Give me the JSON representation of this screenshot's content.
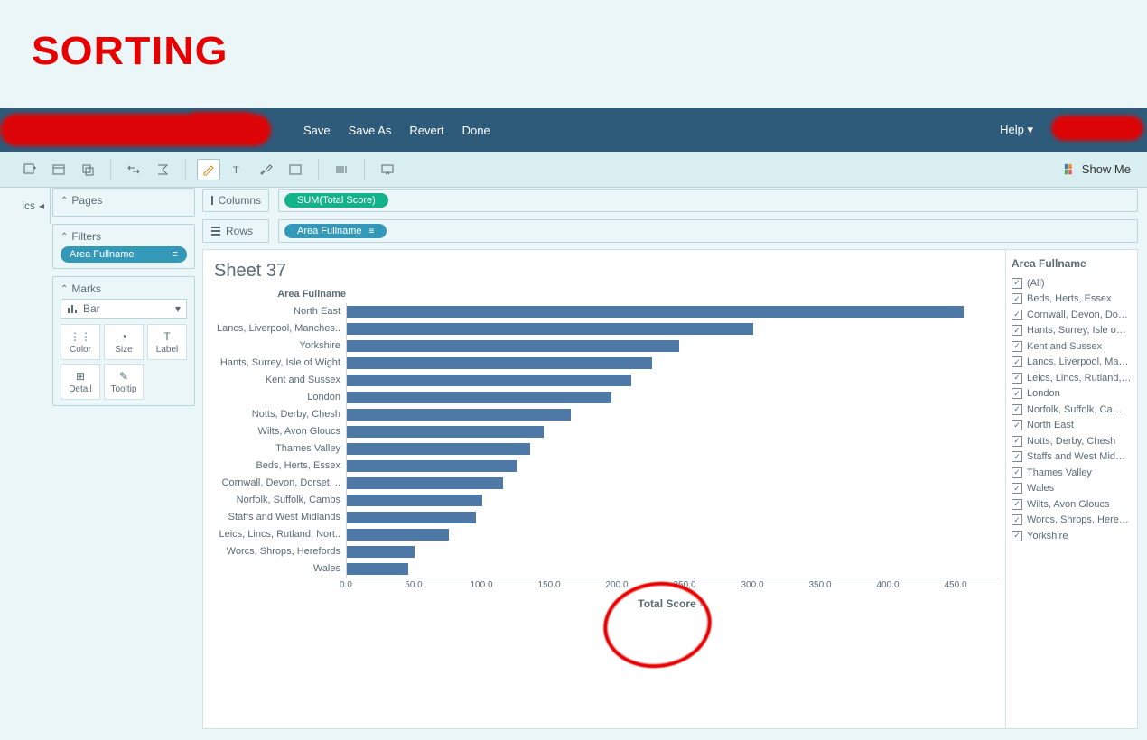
{
  "heading": "SORTING",
  "topbar": {
    "menu": [
      "Save",
      "Save As",
      "Revert",
      "Done"
    ],
    "help": "Help ▾"
  },
  "toolbar": {
    "showme": "Show Me"
  },
  "leftStub": "ics",
  "panels": {
    "pages": "Pages",
    "filters": "Filters",
    "filterPill": "Area Fullname",
    "marks": "Marks",
    "marksType": "Bar",
    "cards": [
      "Color",
      "Size",
      "Label",
      "Detail",
      "Tooltip"
    ]
  },
  "shelves": {
    "columnsLabel": "Columns",
    "columnsPill": "SUM(Total Score)",
    "rowsLabel": "Rows",
    "rowsPill": "Area Fullname"
  },
  "sheet": {
    "title": "Sheet 37",
    "yHeader": "Area Fullname",
    "xTitle": "Total Score"
  },
  "chart_data": {
    "type": "bar",
    "title": "Sheet 37",
    "xlabel": "Total Score",
    "ylabel": "Area Fullname",
    "xlim": [
      0,
      460
    ],
    "ticks": [
      0,
      50,
      100,
      150,
      200,
      250,
      300,
      350,
      400,
      450
    ],
    "categories": [
      "North East",
      "Lancs, Liverpool, Manches..",
      "Yorkshire",
      "Hants, Surrey, Isle of Wight",
      "Kent and Sussex",
      "London",
      "Notts, Derby, Chesh",
      "Wilts, Avon Gloucs",
      "Thames Valley",
      "Beds, Herts, Essex",
      "Cornwall, Devon, Dorset, ..",
      "Norfolk, Suffolk, Cambs",
      "Staffs and West Midlands",
      "Leics, Lincs, Rutland, Nort..",
      "Worcs, Shrops, Herefords",
      "Wales"
    ],
    "values": [
      455,
      300,
      245,
      225,
      210,
      195,
      165,
      145,
      135,
      125,
      115,
      100,
      95,
      75,
      50,
      45
    ]
  },
  "filterPanel": {
    "title": "Area Fullname",
    "items": [
      "(All)",
      "Beds, Herts, Essex",
      "Cornwall, Devon, Do…",
      "Hants, Surrey, Isle o…",
      "Kent and Sussex",
      "Lancs, Liverpool, Ma…",
      "Leics, Lincs, Rutland,…",
      "London",
      "Norfolk, Suffolk, Ca…",
      "North East",
      "Notts, Derby, Chesh",
      "Staffs and West Mid…",
      "Thames Valley",
      "Wales",
      "Wilts, Avon Gloucs",
      "Worcs, Shrops, Here…",
      "Yorkshire"
    ]
  }
}
